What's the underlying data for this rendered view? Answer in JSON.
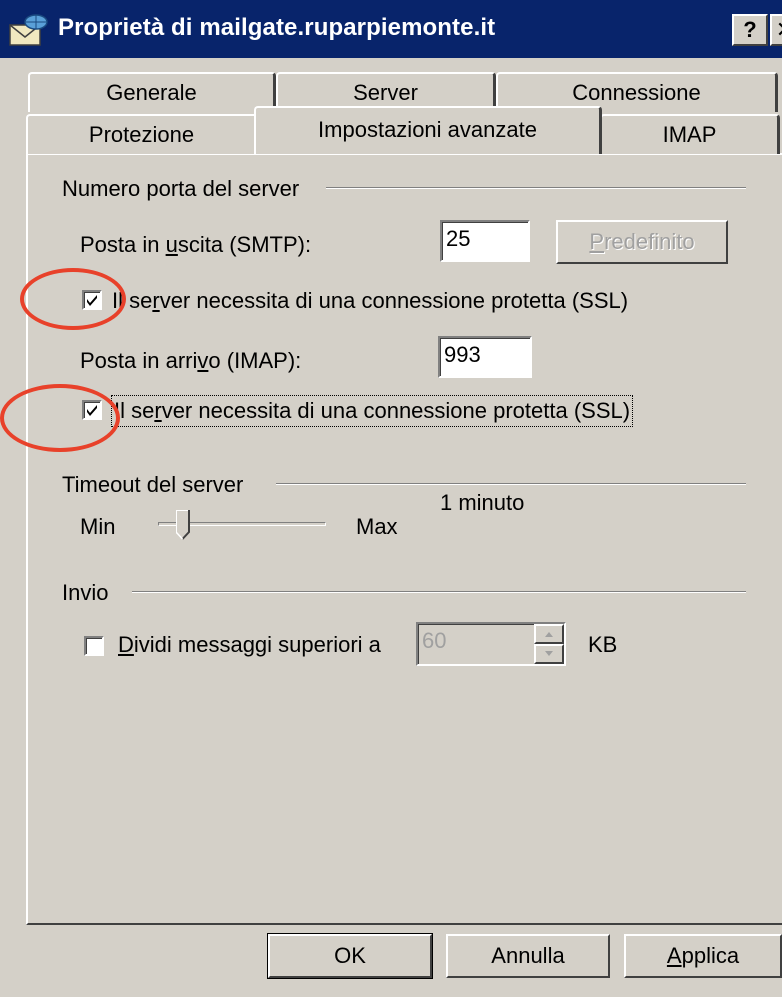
{
  "window": {
    "title": "Proprietà di mailgate.ruparpiemonte.it",
    "help_button": "?",
    "close_button": "✕"
  },
  "tabs": {
    "row_back": [
      "Generale",
      "Server",
      "Connessione"
    ],
    "row_front": [
      "Protezione",
      "Impostazioni avanzate",
      "IMAP"
    ],
    "active": "Impostazioni avanzate"
  },
  "port_group": {
    "title": "Numero porta del server",
    "smtp_label_pre": "Posta in ",
    "smtp_label_u": "u",
    "smtp_label_post": "scita (SMTP):",
    "smtp_value": "25",
    "default_button_u": "P",
    "default_button_rest": "redefinito",
    "smtp_ssl_pre": "Il se",
    "smtp_ssl_u": "r",
    "smtp_ssl_post": "ver necessita di una connessione protetta (SSL)",
    "smtp_ssl_checked": true,
    "imap_label_pre": "Posta in arri",
    "imap_label_u": "v",
    "imap_label_post": "o (IMAP):",
    "imap_value": "993",
    "imap_ssl_pre": "Il se",
    "imap_ssl_u": "r",
    "imap_ssl_post": "ver necessita di una connessione protetta (SSL)",
    "imap_ssl_checked": true
  },
  "timeout_group": {
    "title": "Timeout del server",
    "value_text": "1 minuto",
    "min_label": "Min",
    "max_label": "Max",
    "slider_level": 0.12
  },
  "send_group": {
    "title": "Invio",
    "split_pre": "",
    "split_u": "D",
    "split_post": "ividi messaggi superiori a",
    "split_checked": false,
    "split_value": "60",
    "unit": "KB"
  },
  "buttons": {
    "ok": "OK",
    "cancel": "Annulla",
    "apply_u": "A",
    "apply_rest": "pplica"
  },
  "colors": {
    "title_bar": "#08246b",
    "face": "#d4d0c8",
    "highlight_circle": "#e8412a"
  }
}
